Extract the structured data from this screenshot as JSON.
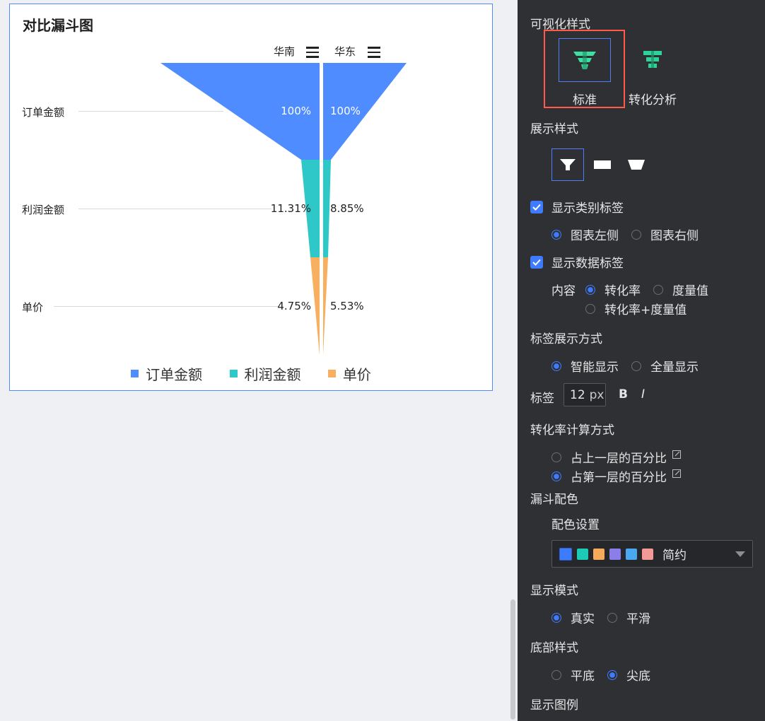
{
  "chart": {
    "title": "对比漏斗图",
    "groups": [
      "华南",
      "华东"
    ],
    "categories": [
      "订单金额",
      "利润金额",
      "单价"
    ],
    "colors": [
      "#4f8cff",
      "#2fc8c8",
      "#f8b060"
    ],
    "left_labels": [
      "100%",
      "11.31%",
      "4.75%"
    ],
    "right_labels": [
      "100%",
      "8.85%",
      "5.53%"
    ],
    "legend": [
      "订单金额",
      "利润金额",
      "单价"
    ]
  },
  "chart_data": {
    "type": "funnel",
    "title": "对比漏斗图",
    "categories": [
      "订单金额",
      "利润金额",
      "单价"
    ],
    "series": [
      {
        "name": "华南",
        "values": [
          100,
          11.31,
          4.75
        ],
        "unit": "%"
      },
      {
        "name": "华东",
        "values": [
          100,
          8.85,
          5.53
        ],
        "unit": "%"
      }
    ],
    "legend_position": "bottom"
  },
  "panel": {
    "vis_style_title": "可视化样式",
    "vis_options": [
      "标准",
      "转化分析"
    ],
    "display_style_title": "展示样式",
    "show_category_label": "显示类别标签",
    "category_pos": [
      "图表左侧",
      "图表右侧"
    ],
    "show_data_label": "显示数据标签",
    "content_label": "内容",
    "content_opts": [
      "转化率",
      "度量值",
      "转化率+度量值"
    ],
    "label_display_title": "标签展示方式",
    "label_display_opts": [
      "智能显示",
      "全量显示"
    ],
    "label_title": "标签",
    "font_size": "12",
    "font_unit": "px",
    "bold": "B",
    "italic": "I",
    "rate_calc_title": "转化率计算方式",
    "rate_calc_opts": [
      "占上一层的百分比",
      "占第一层的百分比"
    ],
    "funnel_color_title": "漏斗配色",
    "color_setting_label": "配色设置",
    "palette_colors": [
      "#3f7bff",
      "#1dc9b7",
      "#f8a95a",
      "#8b7ee8",
      "#4aa8f0",
      "#f39a97"
    ],
    "palette_name": "简约",
    "display_mode_title": "显示模式",
    "display_mode_opts": [
      "真实",
      "平滑"
    ],
    "bottom_style_title": "底部样式",
    "bottom_style_opts": [
      "平底",
      "尖底"
    ],
    "show_legend_title": "显示图例"
  }
}
